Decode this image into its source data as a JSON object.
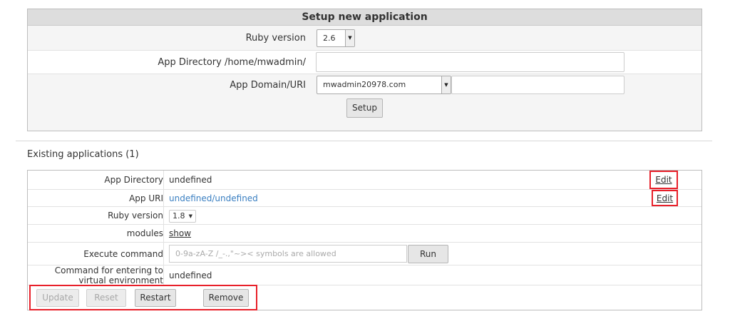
{
  "setup": {
    "title": "Setup new application",
    "ruby_version_label": "Ruby version",
    "ruby_version_value": "2.6",
    "app_directory_label": "App Directory /home/mwadmin/",
    "app_domain_label": "App Domain/URI",
    "app_domain_value": "mwadmin20978.com",
    "setup_button": "Setup"
  },
  "existing": {
    "title": "Existing applications (1)",
    "rows": {
      "app_directory": {
        "label": "App Directory",
        "value": "undefined",
        "action": "Edit"
      },
      "app_uri": {
        "label": "App URI",
        "value": "undefined/undefined",
        "action": "Edit"
      },
      "ruby_version": {
        "label": "Ruby version",
        "value": "1.8"
      },
      "modules": {
        "label": "modules",
        "value": "show"
      },
      "execute_command": {
        "label": "Execute command",
        "placeholder": "0-9a-zA-Z /_-.,\"~>< symbols are allowed",
        "run_button": "Run"
      },
      "command_env": {
        "label_line1": "Command for entering to",
        "label_line2": "virtual environment",
        "value": "undefined"
      }
    },
    "buttons": {
      "update": "Update",
      "reset": "Reset",
      "restart": "Restart",
      "remove": "Remove"
    }
  },
  "colors": {
    "link": "#3a7fc1",
    "highlight": "#e8202a",
    "header_bg": "#dddddd"
  },
  "icons": {
    "dropdown": "caret-down-icon"
  }
}
